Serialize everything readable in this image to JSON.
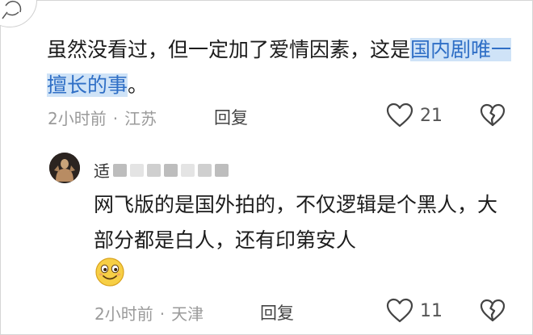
{
  "comment1": {
    "text_plain": "虽然没看过，但一定加了爱情因素，这是",
    "text_highlight": "国内剧唯一擅长的事",
    "text_end": "。",
    "time": "2小时前",
    "separator": "·",
    "location": "江苏",
    "reply_label": "回复",
    "like_count": "21"
  },
  "comment2": {
    "username_visible": "适",
    "text": "网飞版的是国外拍的，不仅逻辑是个黑人，大部分都是白人，还有印第安人",
    "time": "2小时前",
    "separator": "·",
    "location": "天津",
    "reply_label": "回复",
    "like_count": "11"
  },
  "colors": {
    "highlight_bg": "#cfe3f7",
    "highlight_text": "#2f6fc6",
    "meta_text": "#9a9a9a",
    "body_text": "#1c1c1c"
  },
  "icons": [
    "heart-outline-icon",
    "broken-heart-icon",
    "smiley-emoji-icon"
  ]
}
